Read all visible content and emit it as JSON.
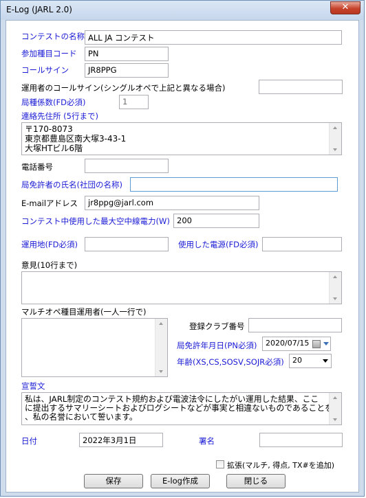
{
  "window": {
    "title": "E-Log (JARL 2.0)",
    "close_label": "✕"
  },
  "fields": {
    "contest_name": {
      "label": "コンテストの名称",
      "value": "ALL JA コンテスト"
    },
    "category_code": {
      "label": "参加種目コード",
      "value": "PN"
    },
    "callsign": {
      "label": "コールサイン",
      "value": "JR8PPG"
    },
    "operator_callsign": {
      "label": "運用者のコールサイン(シングルオペで上記と異なる場合)",
      "value": ""
    },
    "station_coefficient": {
      "label": "局種係数(FD必須)",
      "value": "1"
    },
    "address": {
      "label": "連絡先住所 (5行まで)",
      "lines": "〒170-8073\n東京都豊島区南大塚3-43-1\n大塚HTビル6階"
    },
    "phone": {
      "label": "電話番号",
      "value": ""
    },
    "licensee_name": {
      "label": "局免許者の氏名(社団の名称)",
      "value": ""
    },
    "email": {
      "label": "E-mailアドレス",
      "value": "jr8ppg@jarl.com"
    },
    "max_power": {
      "label": "コンテスト中使用した最大空中線電力(W)",
      "value": "200"
    },
    "operating_location": {
      "label": "運用地(FD必須)",
      "value": ""
    },
    "power_source": {
      "label": "使用した電源(FD必須)",
      "value": ""
    },
    "opinion": {
      "label": "意見(10行まで)",
      "value": ""
    },
    "multi_operators": {
      "label": "マルチオペ種目運用者(一人一行で)",
      "value": ""
    },
    "club_number": {
      "label": "登録クラブ番号",
      "value": ""
    },
    "license_date": {
      "label": "局免許年月日(PN必須)",
      "value": "2020/07/15"
    },
    "age": {
      "label": "年齢(XS,CS,SOSV,SOJR必須)",
      "value": "20"
    },
    "oath": {
      "label": "宣誓文",
      "text": "私は、JARL制定のコンテスト規約および電波法令にしたがい運用した結果、ここ\nに提出するサマリーシートおよびログシートなどが事実と相違ないものであることを\n、私の名誉において誓います。"
    },
    "date": {
      "label": "日付",
      "value": "2022年3月1日"
    },
    "signature": {
      "label": "署名",
      "value": ""
    }
  },
  "extend_checkbox": {
    "label": "拡張(マルチ, 得点, TX#を追加)",
    "checked": false
  },
  "buttons": {
    "save": "保存",
    "create": "E-log作成",
    "close": "閉じる"
  }
}
